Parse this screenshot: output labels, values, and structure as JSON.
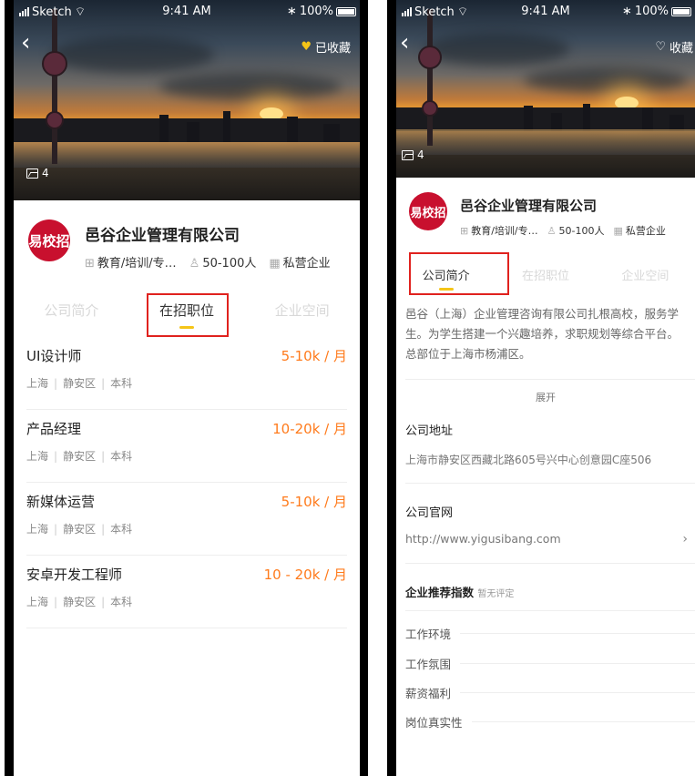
{
  "status_bar": {
    "carrier": "Sketch",
    "time": "9:41 AM",
    "battery": "100%"
  },
  "left": {
    "favorite_label": "已收藏",
    "photo_count": "4",
    "company": {
      "logo_text": "易校招",
      "name": "邑谷企业管理有限公司",
      "industry": "教育/培训/专…",
      "size": "50-100人",
      "type": "私营企业"
    },
    "tabs": [
      {
        "label": "公司简介",
        "active": false
      },
      {
        "label": "在招职位",
        "active": true
      },
      {
        "label": "企业空间",
        "active": false
      }
    ],
    "jobs": [
      {
        "title": "UI设计师",
        "salary": "5-10k / 月",
        "city": "上海",
        "district": "静安区",
        "degree": "本科"
      },
      {
        "title": "产品经理",
        "salary": "10-20k / 月",
        "city": "上海",
        "district": "静安区",
        "degree": "本科"
      },
      {
        "title": "新媒体运营",
        "salary": "5-10k / 月",
        "city": "上海",
        "district": "静安区",
        "degree": "本科"
      },
      {
        "title": "安卓开发工程师",
        "salary": "10 - 20k / 月",
        "city": "上海",
        "district": "静安区",
        "degree": "本科"
      }
    ]
  },
  "right": {
    "favorite_label": "收藏",
    "photo_count": "4",
    "company": {
      "logo_text": "易校招",
      "name": "邑谷企业管理有限公司",
      "industry": "教育/培训/专…",
      "size": "50-100人",
      "type": "私营企业"
    },
    "tabs": [
      {
        "label": "公司简介",
        "active": true
      },
      {
        "label": "在招职位",
        "active": false
      },
      {
        "label": "企业空间",
        "active": false
      }
    ],
    "description_lines": [
      "邑谷（上海）企业管理咨询有限公司扎根高校，服务学",
      "生。为学生搭建一个兴趣培养，求职规划等综合平台。",
      "总部位于上海市杨浦区。"
    ],
    "expand_label": "展开",
    "address_title": "公司地址",
    "address": "上海市静安区西藏北路605号兴中心创意园C座506",
    "website_title": "公司官网",
    "website": "http://www.yigusibang.com",
    "rating_title": "企业推荐指数",
    "rating_status": "暂无评定",
    "ratings": [
      "工作环境",
      "工作氛围",
      "薪资福利",
      "岗位真实性"
    ]
  },
  "colors": {
    "accent": "#f5c518",
    "salary": "#ff7b1c",
    "highlight_box": "#e0221e",
    "logo": "#c8102e"
  }
}
